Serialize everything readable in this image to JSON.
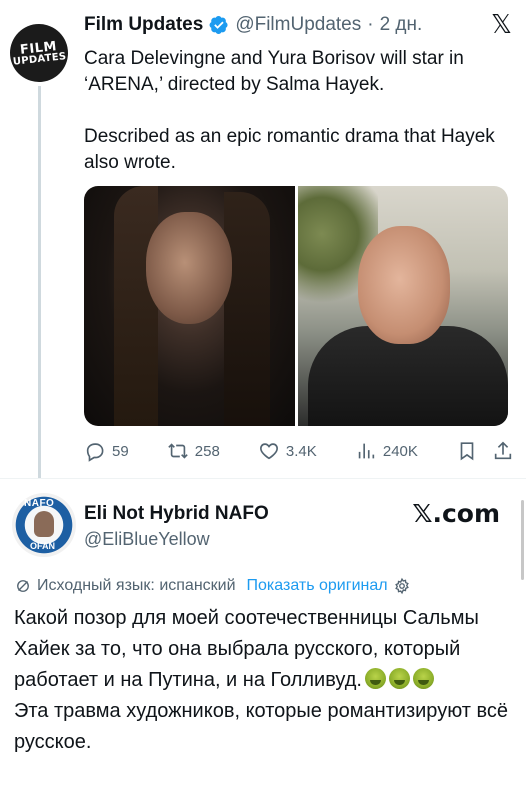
{
  "tweet1": {
    "avatar_text": [
      "FILM",
      "UPDATES"
    ],
    "name": "Film Updates",
    "handle": "@FilmUpdates",
    "separator": "·",
    "time": "2 дн.",
    "text_paragraphs": [
      "Cara Delevingne and Yura Borisov will star in ‘ARENA,’ directed by Salma Hayek.",
      "Described as an epic romantic drama that Hayek also wrote."
    ],
    "actions": {
      "replies": "59",
      "reposts": "258",
      "likes": "3.4K",
      "views": "240K"
    },
    "icons": {
      "verified": "verified-badge-icon",
      "brand": "x-logo-icon",
      "reply": "reply-icon",
      "repost": "repost-icon",
      "like": "heart-icon",
      "views": "views-icon",
      "bookmark": "bookmark-icon",
      "share": "share-icon"
    },
    "brand_glyph": "𝕏"
  },
  "tweet2": {
    "avatar_text": [
      "NAFO",
      "OFAN"
    ],
    "name": "Eli Not Hybrid NAFO",
    "handle": "@EliBlueYellow",
    "brand": "𝕏.com",
    "translation": {
      "label": "Исходный язык: испанский",
      "show_original": "Показать оригинал"
    },
    "text_lines": {
      "p1": "Какой позор для моей соотечественницы Сальмы Хайек за то, что она выбрала русского, который работает и на Путина, и на Голливуд.",
      "p2": "Эта травма художников, которые романтизируют всё русское."
    },
    "emoji_count": 3,
    "emoji_name": "nauseated-face-icon"
  },
  "colors": {
    "text": "#0f1419",
    "secondary": "#536471",
    "link": "#1d9bf0",
    "verified": "#1d9bf0",
    "divider": "#eff3f4"
  }
}
